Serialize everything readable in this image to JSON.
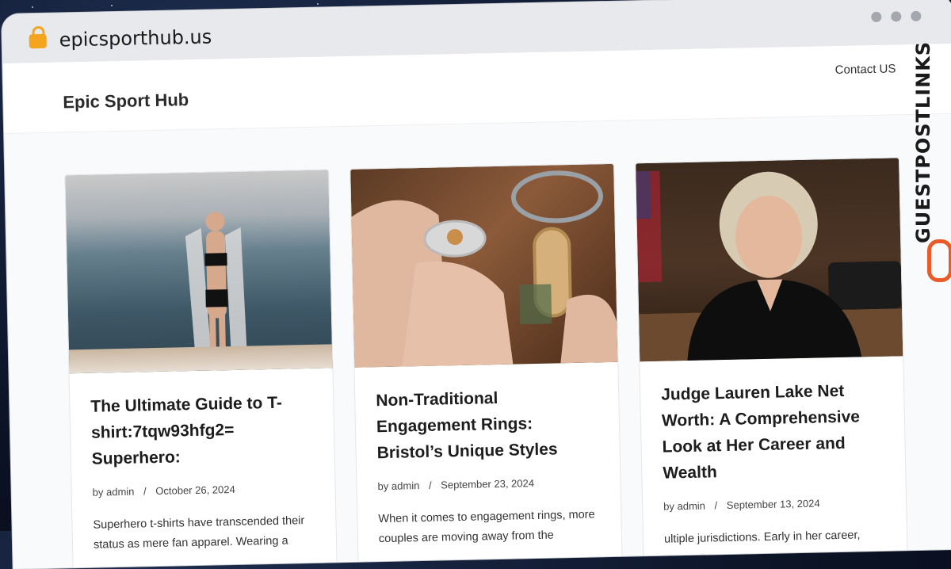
{
  "browser": {
    "url": "epicsporthub.us"
  },
  "site": {
    "title": "Epic Sport Hub",
    "nav": [
      {
        "label": "Contact US"
      }
    ]
  },
  "posts": [
    {
      "title": "The Ultimate Guide to T-shirt:7tqw93hfg2= Superhero:",
      "author_prefix": "by",
      "author": "admin",
      "separator": "/",
      "date": "October 26, 2024",
      "excerpt": "Superhero t-shirts have transcended their status as mere fan apparel. Wearing a"
    },
    {
      "title": "Non-Traditional Engagement Rings: Bristol’s Unique Styles",
      "author_prefix": "by",
      "author": "admin",
      "separator": "/",
      "date": "September 23, 2024",
      "excerpt": "When it comes to engagement rings, more couples are moving away from the"
    },
    {
      "title": "Judge Lauren Lake Net Worth: A Comprehensive Look at Her Career and Wealth",
      "author_prefix": "by",
      "author": "admin",
      "separator": "/",
      "date": "September 13, 2024",
      "excerpt": "ultiple jurisdictions. Early in her career,"
    }
  ],
  "watermark": {
    "brand": "GUESTPOSTLINKS",
    "accent": "#ea5b2a"
  }
}
